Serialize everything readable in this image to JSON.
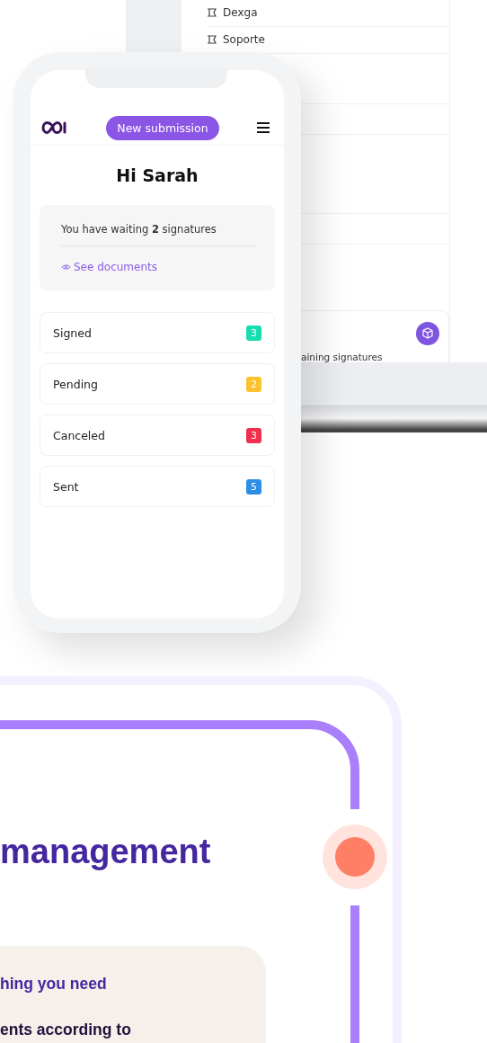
{
  "desktop": {
    "sidebar_items": [
      "Dexga",
      "Soporte"
    ],
    "card_text": "aining signatures"
  },
  "phone": {
    "button": "New submission",
    "greeting": "Hi Sarah",
    "notice": "You have waiting **2** signatures",
    "link": "See documents",
    "statuses": [
      {
        "label": "Signed",
        "count": "3",
        "color": "#16dcb0"
      },
      {
        "label": "Pending",
        "count": "2",
        "color": "#fcc22d"
      },
      {
        "label": "Canceled",
        "count": "3",
        "color": "#f0304d"
      },
      {
        "label": "Sent",
        "count": "5",
        "color": "#2d8ee6"
      }
    ]
  },
  "section": {
    "heading": "management",
    "items": [
      {
        "text": "hing you need",
        "kind": "highlight"
      },
      {
        "text": "ents according to",
        "kind": "plain"
      }
    ]
  }
}
